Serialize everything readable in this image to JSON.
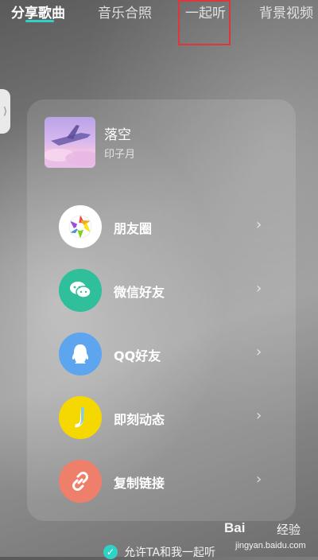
{
  "tabs": [
    {
      "label": "分享歌曲",
      "active": true
    },
    {
      "label": "音乐合照",
      "active": false
    },
    {
      "label": "一起听",
      "active": false
    },
    {
      "label": "背景视频",
      "active": false
    }
  ],
  "side_handle": {
    "glyph": "⟩"
  },
  "song": {
    "title": "落空",
    "artist": "印子月"
  },
  "share_options": [
    {
      "label": "朋友圈",
      "icon": "moments-icon",
      "icon_bg": "#ffffff"
    },
    {
      "label": "微信好友",
      "icon": "wechat-icon",
      "icon_bg": "#2fbf9a"
    },
    {
      "label": "QQ好友",
      "icon": "qq-icon",
      "icon_bg": "#5ea5ef"
    },
    {
      "label": "即刻动态",
      "icon": "jike-icon",
      "icon_bg": "#f5d800"
    },
    {
      "label": "复制链接",
      "icon": "link-icon",
      "icon_bg": "#ee7f6a"
    }
  ],
  "chevron_glyph": "›",
  "bottom_option": {
    "label": "允许TA和我一起听",
    "checked": true
  },
  "watermark": {
    "logo": "Bai",
    "text": "经验",
    "url": "jingyan.baidu.com"
  },
  "colors": {
    "accent": "#2fd3c6",
    "highlight_border": "#e0353b"
  }
}
